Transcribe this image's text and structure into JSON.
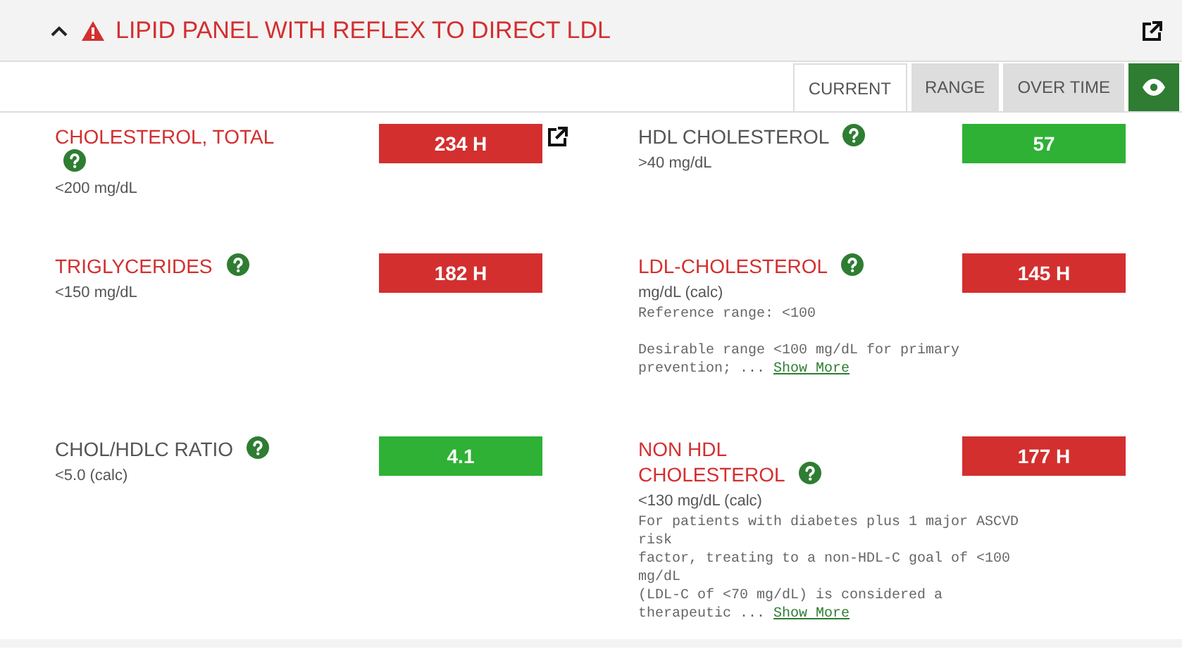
{
  "panel": {
    "title": "LIPID PANEL WITH REFLEX TO DIRECT LDL",
    "expanded": true,
    "abnormal": true
  },
  "view_tabs": [
    {
      "label": "CURRENT",
      "selected": true
    },
    {
      "label": "RANGE",
      "selected": false
    },
    {
      "label": "OVER TIME",
      "selected": false
    }
  ],
  "results": [
    {
      "name": "CHOLESTEROL, TOTAL",
      "abnormal": true,
      "reference": "<200 mg/dL",
      "value": "234 H",
      "external_link": true
    },
    {
      "name": "HDL CHOLESTEROL",
      "abnormal": false,
      "reference": ">40 mg/dL",
      "value": "57"
    },
    {
      "name": "TRIGLYCERIDES",
      "abnormal": true,
      "reference": "<150 mg/dL",
      "value": "182 H"
    },
    {
      "name": "LDL-CHOLESTEROL",
      "abnormal": true,
      "reference": "mg/dL (calc)",
      "value": "145 H",
      "note_paragraphs": [
        [
          "Reference range: <100"
        ],
        [
          "Desirable range <100 mg/dL for primary",
          "prevention;  ..."
        ]
      ],
      "show_more": "Show More"
    },
    {
      "name": "CHOL/HDLC RATIO",
      "abnormal": false,
      "reference": "<5.0 (calc)",
      "value": "4.1"
    },
    {
      "name": "NON HDL CHOLESTEROL",
      "abnormal": true,
      "reference": "<130 mg/dL (calc)",
      "value": "177 H",
      "note_paragraphs": [
        [
          "For patients with diabetes plus 1 major ASCVD",
          "risk",
          "factor, treating to a non-HDL-C goal of <100",
          "mg/dL",
          "(LDL-C of <70 mg/dL) is considered a",
          "therapeutic  ..."
        ]
      ],
      "show_more": "Show More"
    }
  ]
}
